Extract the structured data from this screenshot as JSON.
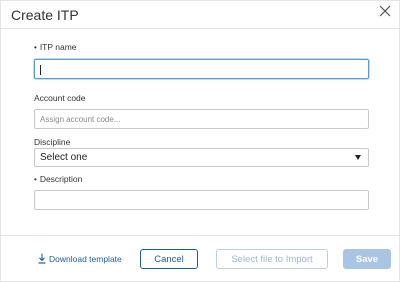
{
  "dialog": {
    "title": "Create ITP",
    "close_icon": "close-icon"
  },
  "form": {
    "itp_name": {
      "label": "ITP name",
      "required_marker": "•",
      "value": ""
    },
    "account_code": {
      "label": "Account code",
      "placeholder": "Assign account code..."
    },
    "discipline": {
      "label": "Discipline",
      "selected": "Select one"
    },
    "description": {
      "label": "Description",
      "required_marker": "•",
      "value": ""
    }
  },
  "footer": {
    "download_label": "Download template",
    "download_icon": "download-icon",
    "cancel_label": "Cancel",
    "import_label": "Select file to Import",
    "save_label": "Save"
  },
  "colors": {
    "accent": "#1f5d99",
    "focus_border": "#5b9bd5",
    "disabled_button": "#a9c5e3"
  }
}
